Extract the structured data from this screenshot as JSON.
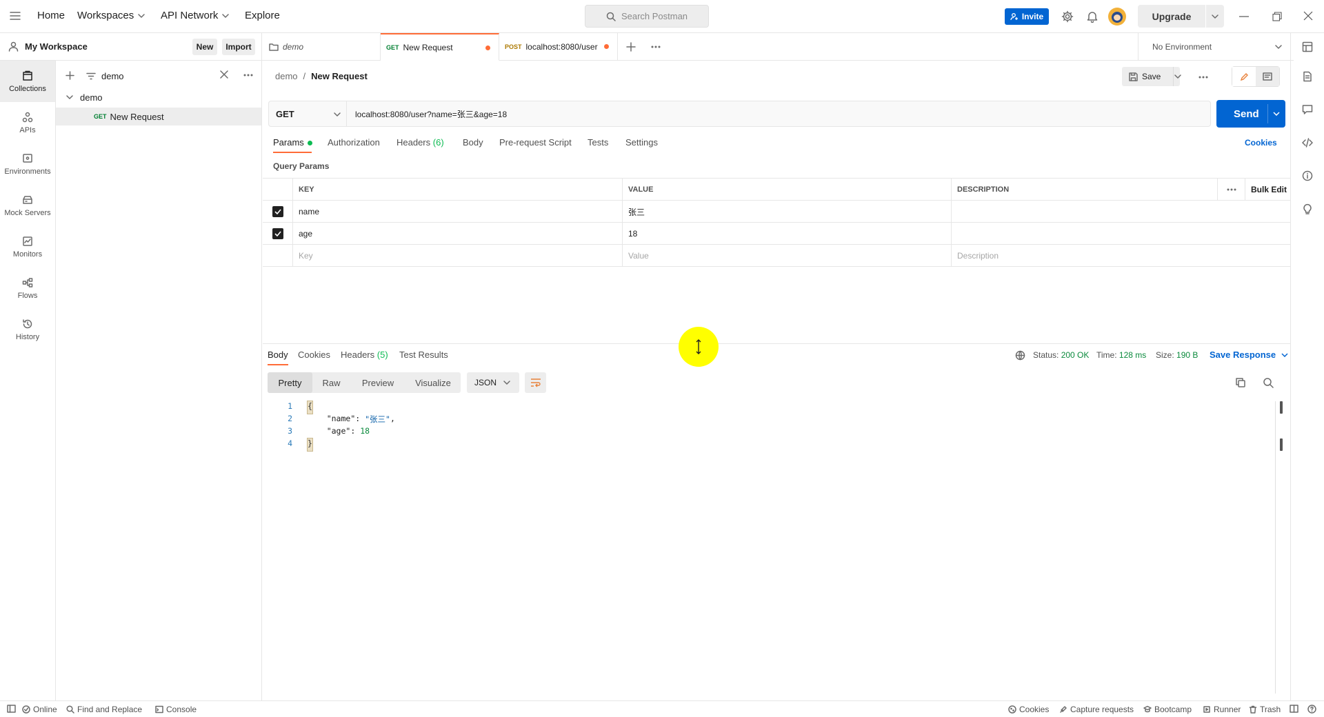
{
  "topbar": {
    "home": "Home",
    "workspaces": "Workspaces",
    "api_network": "API Network",
    "explore": "Explore",
    "search_placeholder": "Search Postman",
    "invite": "Invite",
    "upgrade": "Upgrade"
  },
  "workspace": {
    "name": "My Workspace",
    "new_label": "New",
    "import_label": "Import"
  },
  "tabs": [
    {
      "method": "",
      "label": "demo"
    },
    {
      "method": "GET",
      "label": "New Request"
    },
    {
      "method": "POST",
      "label": "localhost:8080/user"
    }
  ],
  "environment": "No Environment",
  "rail": [
    {
      "label": "Collections",
      "icon": "collections-icon"
    },
    {
      "label": "APIs",
      "icon": "apis-icon"
    },
    {
      "label": "Environments",
      "icon": "environments-icon"
    },
    {
      "label": "Mock Servers",
      "icon": "mock-servers-icon"
    },
    {
      "label": "Monitors",
      "icon": "monitors-icon"
    },
    {
      "label": "Flows",
      "icon": "flows-icon"
    },
    {
      "label": "History",
      "icon": "history-icon"
    }
  ],
  "sidebar": {
    "filter_value": "demo",
    "collection": "demo",
    "request_method": "GET",
    "request_name": "New Request"
  },
  "request": {
    "breadcrumb_parent": "demo",
    "breadcrumb_sep": "/",
    "breadcrumb_current": "New Request",
    "save_label": "Save",
    "method": "GET",
    "url": "localhost:8080/user?name=张三&age=18",
    "send_label": "Send",
    "tabs": {
      "params": "Params",
      "authorization": "Authorization",
      "headers": "Headers",
      "headers_count": "(6)",
      "body": "Body",
      "prerequest": "Pre-request Script",
      "tests": "Tests",
      "settings": "Settings"
    },
    "cookies_label": "Cookies",
    "query_params_title": "Query Params"
  },
  "params_table": {
    "headers": {
      "key": "KEY",
      "value": "VALUE",
      "description": "DESCRIPTION",
      "bulk_edit": "Bulk Edit"
    },
    "rows": [
      {
        "key": "name",
        "value": "张三",
        "description": "",
        "checked": true
      },
      {
        "key": "age",
        "value": "18",
        "description": "",
        "checked": true
      }
    ],
    "placeholders": {
      "key": "Key",
      "value": "Value",
      "description": "Description"
    }
  },
  "response": {
    "tabs": {
      "body": "Body",
      "cookies": "Cookies",
      "headers": "Headers",
      "headers_count": "(5)",
      "test_results": "Test Results"
    },
    "status_label": "Status:",
    "status_value": "200 OK",
    "time_label": "Time:",
    "time_value": "128 ms",
    "size_label": "Size:",
    "size_value": "190 B",
    "save_response": "Save Response",
    "formats": [
      "Pretty",
      "Raw",
      "Preview",
      "Visualize"
    ],
    "language": "JSON",
    "code": {
      "line1_no": "1",
      "line2_no": "2",
      "line3_no": "3",
      "line4_no": "4",
      "open_brace": "{",
      "close_brace": "}",
      "name_key": "\"name\"",
      "name_value": "\"张三\"",
      "age_key": "\"age\"",
      "age_value": "18",
      "colon": ": ",
      "comma": ","
    }
  },
  "statusbar": {
    "online": "Online",
    "find_replace": "Find and Replace",
    "console": "Console",
    "cookies": "Cookies",
    "capture": "Capture requests",
    "bootcamp": "Bootcamp",
    "runner": "Runner",
    "trash": "Trash"
  },
  "colors": {
    "accent": "#ff6c37",
    "primary": "#0265d2",
    "get_method": "#007f31",
    "post_method": "#ad7a03",
    "status_ok": "#0cbb52"
  }
}
